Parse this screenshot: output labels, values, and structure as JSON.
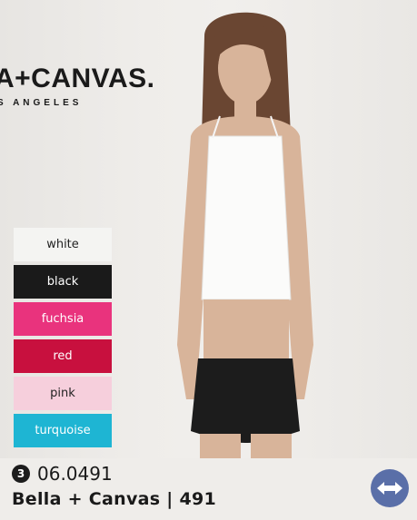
{
  "brand": {
    "name": "A+CANVAS.",
    "subline": "S ANGELES"
  },
  "swatches": [
    {
      "label": "white",
      "bg": "#f4f4f2",
      "fg": "#222222"
    },
    {
      "label": "black",
      "bg": "#1a1a1a",
      "fg": "#ffffff"
    },
    {
      "label": "fuchsia",
      "bg": "#e9337d",
      "fg": "#ffffff"
    },
    {
      "label": "red",
      "bg": "#c8103e",
      "fg": "#ffffff"
    },
    {
      "label": "pink",
      "bg": "#f6cfdc",
      "fg": "#222222"
    },
    {
      "label": "turquoise",
      "bg": "#1eb5d3",
      "fg": "#ffffff"
    }
  ],
  "product": {
    "index_badge": "3",
    "article_number": "06.0491",
    "title": "Bella + Canvas | 491"
  },
  "icons": {
    "stretch": "stretch-arrows-icon",
    "accent": "#5a6fa8"
  }
}
